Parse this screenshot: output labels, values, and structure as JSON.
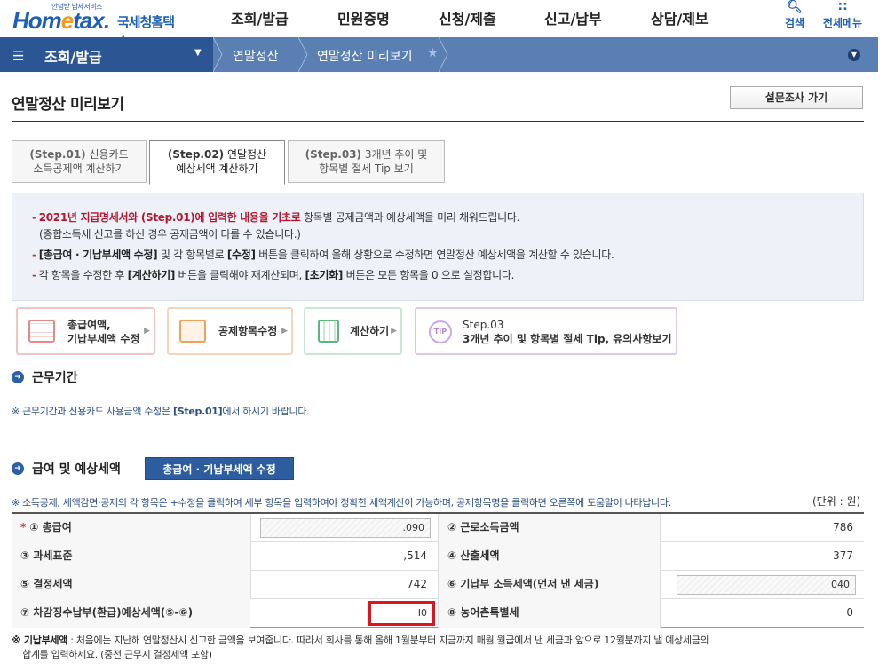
{
  "header": {
    "logo_tagline": "안녕받 납세서비스",
    "logo_brand_a": "Hom",
    "logo_brand_e": "e",
    "logo_brand_b": "tax.",
    "logo_korean": "국세청홈택스",
    "gnb": [
      "조회/발급",
      "민원증명",
      "신청/제출",
      "신고/납부",
      "상담/제보"
    ],
    "search_label": "검색",
    "allmenu_label": "전체메뉴"
  },
  "navbar": {
    "menu_label": "조회/발급",
    "crumbs": [
      "연말정산",
      "연말정산 미리보기"
    ]
  },
  "page": {
    "title": "연말정산 미리보기",
    "survey_button": "설문조사 가기"
  },
  "tabs": [
    {
      "step": "(Step.01)",
      "line1": "신용카드",
      "line2": "소득공제액 계산하기"
    },
    {
      "step": "(Step.02)",
      "line1": "연말정산",
      "line2": "예상세액 계산하기"
    },
    {
      "step": "(Step.03)",
      "line1": "3개년 추이 및",
      "line2": "항목별 절세 Tip 보기"
    }
  ],
  "info": {
    "l1_red": "2021년 지급명세서와 (Step.01)에 입력한 내용을 기초로",
    "l1_rest": " 항목별 공제금액과 예상세액을 미리 채워드립니다.",
    "l2": "(종합소득세 신고를 하신 경우 공제금액이 다를 수 있습니다.)",
    "l3_a": "[총급여 · 기납부세액 수정]",
    "l3_b": " 및 각 항목별로 ",
    "l3_c": "[수정]",
    "l3_d": " 버튼을 클릭하여 올해 상황으로 수정하면 연말정산 예상세액을 계산할 수 있습니다.",
    "l4_a": "각 항목을 수정한 후 ",
    "l4_b": "[계산하기]",
    "l4_c": " 버튼을 클릭해야 재계산되며, ",
    "l4_d": "[초기화]",
    "l4_e": " 버튼은 모든 항목을 0 으로 설정합니다."
  },
  "steps": [
    {
      "line1": "총급여액,",
      "line2": "기납부세액 수정"
    },
    {
      "line1": "공제항목수정"
    },
    {
      "line1": "계산하기"
    },
    {
      "icon_text": "TIP",
      "line1": "Step.03",
      "line2": "3개년 추이 및 항목별 절세 Tip, 유의사항보기"
    }
  ],
  "section1": {
    "title": "근무기간",
    "note_a": "※ 근무기간과 신용카드 사용금액 수정은 ",
    "note_b": "[Step.01]",
    "note_c": "에서 하시기 바랍니다."
  },
  "section2": {
    "title": "급여 및 예상세액",
    "edit_button": "총급여 · 기납부세액 수정",
    "note": "※ 소득공제, 세액감면·공제의 각 항목은 +수정을 클릭하여 세부 항목을 입력하여야 정확한 세액계산이 가능하며, 공제항목명을 클릭하면 오른쪽에 도움말이 나타납니다.",
    "unit": "(단위 : 원)"
  },
  "table": [
    {
      "l_label": "① 총급여",
      "l_value": ".090",
      "r_label": "② 근로소득금액",
      "r_value": "786"
    },
    {
      "l_label": "③ 과세표준",
      "l_value": ",514",
      "r_label": "④ 산출세액",
      "r_value": "377"
    },
    {
      "l_label": "⑤ 결정세액",
      "l_value": "742",
      "r_label": "⑥ 기납부 소득세액(먼저 낸 세금)",
      "r_value": "040"
    },
    {
      "l_label": "⑦ 차감징수납부(환급)예상세액(⑤-⑥)",
      "l_value": "I0",
      "r_label": "⑧ 농어촌특별세",
      "r_value": "0"
    }
  ],
  "required_mark": "*",
  "footer": {
    "label": "※ 기납부세액",
    "line1": " : 처음에는 지난해 연말정산시 신고한 금액을 보여줍니다. 따라서 회사를 통해 올해 1월분부터 지금까지 매월 월급에서 낸 세금과 앞으로 12월분까지 낼 예상세금의",
    "line2": "합계를 입력하세요. (중전 근무지 결정세액 포함)"
  }
}
